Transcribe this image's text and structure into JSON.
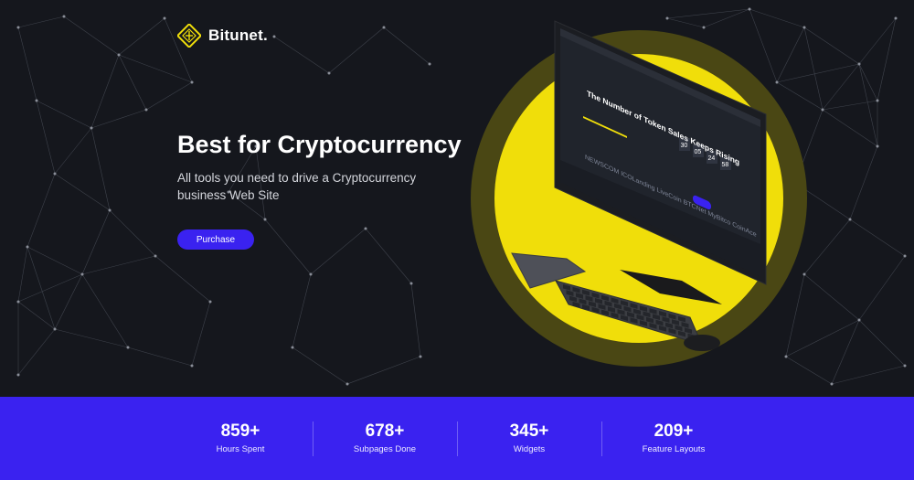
{
  "brand": {
    "name": "Bitunet."
  },
  "hero": {
    "headline": "Best for Cryptocurrency",
    "subtext": "All tools you need to drive a Cryptocurrency business Web Site",
    "cta_label": "Purchase"
  },
  "screen": {
    "title": "The Number of Token Sales Keeps Rising",
    "countdown": [
      "30",
      "05",
      "24",
      "58"
    ],
    "button_label": "Buy Token",
    "partners": [
      "NEWSCOM",
      "ICOLanding",
      "LiveCoin",
      "BTCNet",
      "MyBitco",
      "CoinAce"
    ]
  },
  "stats": [
    {
      "value": "859+",
      "label": "Hours Spent"
    },
    {
      "value": "678+",
      "label": "Subpages Done"
    },
    {
      "value": "345+",
      "label": "Widgets"
    },
    {
      "value": "209+",
      "label": "Feature Layouts"
    }
  ],
  "colors": {
    "background": "#15171d",
    "accent_blue": "#3a22f0",
    "accent_yellow": "#f0de0a",
    "ring_dark": "#4a4714"
  }
}
